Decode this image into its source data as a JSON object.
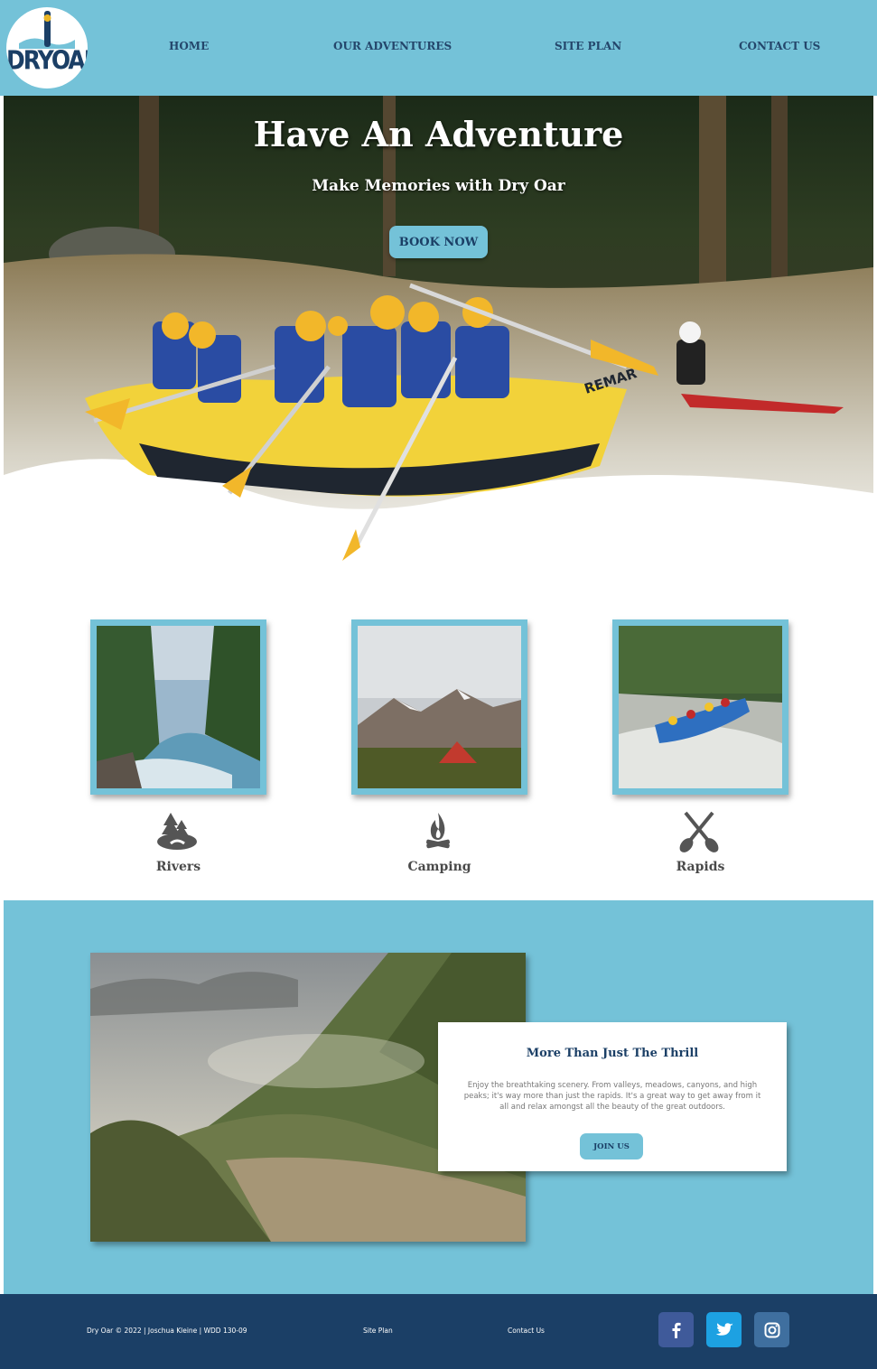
{
  "colors": {
    "accent": "#74c2d8",
    "navy": "#1b3f66",
    "facebook": "#3f5a9a",
    "twitter": "#1da1e2",
    "instagram": "#3f6f9f"
  },
  "header": {
    "logo_text": "DRYOAR",
    "logo_icon": "paddle-icon",
    "nav": [
      "HOME",
      "OUR ADVENTURES",
      "SITE PLAN",
      "CONTACT US"
    ]
  },
  "hero": {
    "title": "Have An Adventure",
    "subtitle": "Make Memories with Dry Oar",
    "button": "BOOK NOW"
  },
  "activities": [
    {
      "label": "Rivers",
      "icon": "river-trees-icon"
    },
    {
      "label": "Camping",
      "icon": "campfire-icon"
    },
    {
      "label": "Rapids",
      "icon": "crossed-paddles-icon"
    }
  ],
  "feature": {
    "title": "More Than Just The Thrill",
    "text": "Enjoy the breathtaking scenery. From valleys, meadows, canyons, and high peaks; it's way more than just the rapids. It's a great way to get away from it all and relax amongst all the beauty of the great outdoors.",
    "button": "JOIN US"
  },
  "footer": {
    "copyright": "Dry Oar © 2022 | Joschua Kleine | WDD 130-09",
    "site_plan": "Site Plan",
    "contact": "Contact Us",
    "social": [
      "facebook-icon",
      "twitter-icon",
      "instagram-icon"
    ]
  }
}
